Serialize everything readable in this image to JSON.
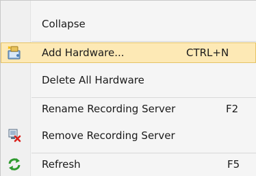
{
  "menu": {
    "items": [
      {
        "label": "Collapse",
        "shortcut": "",
        "icon": null
      },
      {
        "label": "Add Hardware...",
        "shortcut": "CTRL+N",
        "icon": "add-hardware-icon",
        "highlighted": true
      },
      {
        "label": "Delete All Hardware",
        "shortcut": "",
        "icon": null
      },
      {
        "label": "Rename Recording Server",
        "shortcut": "F2",
        "icon": null
      },
      {
        "label": "Remove Recording Server",
        "shortcut": "",
        "icon": "remove-server-icon"
      },
      {
        "label": "Refresh",
        "shortcut": "F5",
        "icon": "refresh-icon"
      }
    ]
  },
  "colors": {
    "highlight_bg": "#fde9b5",
    "highlight_border": "#e5c365",
    "menu_bg": "#f5f5f5"
  }
}
